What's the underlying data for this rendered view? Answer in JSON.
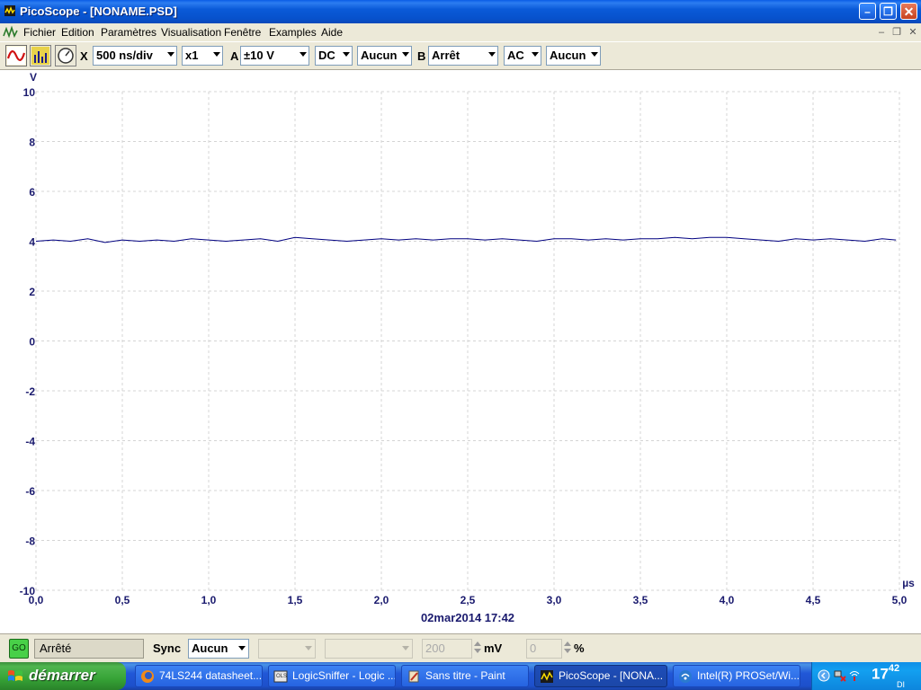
{
  "window": {
    "title": "PicoScope - [NONAME.PSD]",
    "controls": [
      "minimize",
      "restore",
      "close"
    ]
  },
  "menu": {
    "items": [
      "Fichier",
      "Edition",
      "Paramètres",
      "Visualisation",
      "Fenêtre",
      "Examples",
      "Aide"
    ]
  },
  "toolbar": {
    "timebase": "500 ns/div",
    "x_label": "X",
    "zoom": "x1",
    "ch_a_label": "A",
    "ch_a_range": "±10 V",
    "ch_a_coupling": "DC",
    "ch_a_option": "Aucun",
    "ch_b_label": "B",
    "ch_b_range": "Arrêt",
    "ch_b_coupling": "AC",
    "ch_b_option": "Aucun"
  },
  "chart_data": {
    "type": "line",
    "y_unit": "V",
    "x_unit": "µs",
    "y_ticks": [
      "10",
      "8",
      "6",
      "4",
      "2",
      "0",
      "-2",
      "-4",
      "-6",
      "-8",
      "-10"
    ],
    "x_ticks": [
      "0,0",
      "0,5",
      "1,0",
      "1,5",
      "2,0",
      "2,5",
      "3,0",
      "3,5",
      "4,0",
      "4,5",
      "5,0"
    ],
    "xlim": [
      0,
      5
    ],
    "ylim": [
      -10,
      10
    ],
    "grid": true,
    "timestamp": "02mar2014  17:42",
    "series": [
      {
        "color": "#000080",
        "x": [
          0.0,
          0.1,
          0.2,
          0.3,
          0.4,
          0.5,
          0.6,
          0.7,
          0.8,
          0.9,
          1.0,
          1.1,
          1.2,
          1.3,
          1.4,
          1.5,
          1.6,
          1.7,
          1.8,
          1.9,
          2.0,
          2.1,
          2.2,
          2.3,
          2.4,
          2.5,
          2.6,
          2.7,
          2.8,
          2.9,
          3.0,
          3.1,
          3.2,
          3.3,
          3.4,
          3.5,
          3.6,
          3.7,
          3.8,
          3.9,
          4.0,
          4.1,
          4.2,
          4.3,
          4.4,
          4.5,
          4.6,
          4.7,
          4.8,
          4.9,
          4.98
        ],
        "values": [
          4.0,
          4.05,
          4.0,
          4.1,
          3.95,
          4.05,
          4.0,
          4.05,
          4.0,
          4.1,
          4.05,
          4.0,
          4.05,
          4.1,
          4.0,
          4.15,
          4.1,
          4.05,
          4.0,
          4.05,
          4.1,
          4.05,
          4.1,
          4.05,
          4.1,
          4.1,
          4.05,
          4.1,
          4.05,
          4.0,
          4.1,
          4.1,
          4.05,
          4.1,
          4.05,
          4.1,
          4.1,
          4.15,
          4.1,
          4.15,
          4.15,
          4.1,
          4.05,
          4.0,
          4.1,
          4.05,
          4.1,
          4.05,
          4.0,
          4.1,
          4.05
        ]
      }
    ]
  },
  "status": {
    "go_label": "GO",
    "state": "Arrêté",
    "sync_label": "Sync",
    "sync_value": "Aucun",
    "level_value": "200",
    "level_unit": "mV",
    "percent_value": "0",
    "percent_unit": "%"
  },
  "taskbar": {
    "start_label": "démarrer",
    "items": [
      {
        "label": "74LS244 datasheet...",
        "icon": "firefox-icon"
      },
      {
        "label": "LogicSniffer - Logic ...",
        "icon": "logicsniffer-icon"
      },
      {
        "label": "Sans titre - Paint",
        "icon": "paint-icon"
      },
      {
        "label": "PicoScope - [NONA...",
        "icon": "picoscope-icon"
      },
      {
        "label": "Intel(R) PROSet/Wi...",
        "icon": "wireless-icon"
      }
    ],
    "clock_hour": "17",
    "clock_minute": "42",
    "clock_day": "DI"
  }
}
